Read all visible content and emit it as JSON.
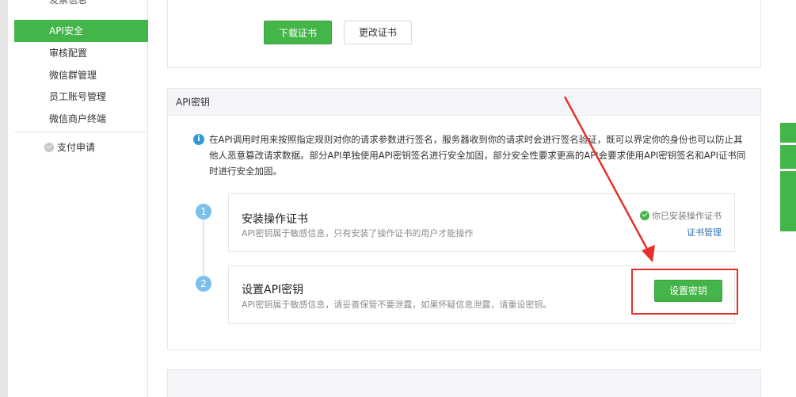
{
  "sidebar": {
    "cut_item": "发票信息",
    "items": [
      {
        "label": "API安全",
        "active": true
      },
      {
        "label": "审核配置",
        "active": false
      },
      {
        "label": "微信群管理",
        "active": false
      },
      {
        "label": "员工账号管理",
        "active": false
      },
      {
        "label": "微信商户终端",
        "active": false
      }
    ],
    "group_label": "支付申请"
  },
  "cert_section": {
    "download_label": "下载证书",
    "change_label": "更改证书"
  },
  "api_key_section": {
    "title": "API密钥",
    "notice": "在API调用时用来按照指定规则对你的请求参数进行签名，服务器收到你的请求时会进行签名验证，既可以界定你的身份也可以防止其他人恶意篡改请求数据。部分API单独使用API密钥签名进行安全加固，部分安全性要求更高的API会要求使用API密钥签名和API证书同时进行安全加固。",
    "steps": [
      {
        "number": "1",
        "title": "安装操作证书",
        "desc": "API密钥属于敏感信息，只有安装了操作证书的用户才能操作",
        "status": "你已安装操作证书",
        "link": "证书管理"
      },
      {
        "number": "2",
        "title": "设置API密钥",
        "desc": "API密钥属于敏感信息，请妥善保管不要泄露，如果怀疑信息泄露，请重设密钥。",
        "button": "设置密钥"
      }
    ]
  },
  "colors": {
    "accent_green": "#44b549",
    "info_blue": "#2f9bd6",
    "annotation_red": "#e5312b"
  }
}
